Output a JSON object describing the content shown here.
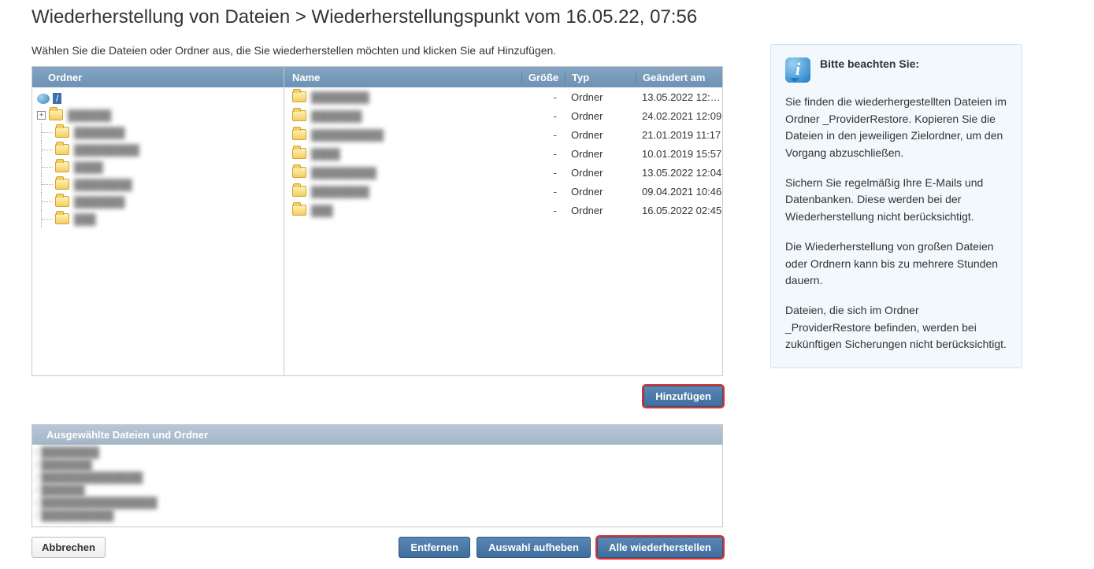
{
  "title": "Wiederherstellung von Dateien > Wiederherstellungspunkt vom 16.05.22, 07:56",
  "instructions": "Wählen Sie die Dateien oder Ordner aus, die Sie wiederherstellen möchten und klicken Sie auf Hinzufügen.",
  "tree": {
    "header": "Ordner",
    "root": "/",
    "items": [
      "██████",
      "███████",
      "█████████",
      "████",
      "████████",
      "███████",
      "███"
    ]
  },
  "list": {
    "headers": {
      "name": "Name",
      "size": "Größe",
      "type": "Typ",
      "date": "Geändert am"
    },
    "rows": [
      {
        "name": "████████",
        "size": "-",
        "type": "Ordner",
        "date": "13.05.2022 12:…"
      },
      {
        "name": "███████",
        "size": "-",
        "type": "Ordner",
        "date": "24.02.2021 12:09"
      },
      {
        "name": "██████████",
        "size": "-",
        "type": "Ordner",
        "date": "21.01.2019 11:17"
      },
      {
        "name": "████",
        "size": "-",
        "type": "Ordner",
        "date": "10.01.2019 15:57"
      },
      {
        "name": "█████████",
        "size": "-",
        "type": "Ordner",
        "date": "13.05.2022 12:04"
      },
      {
        "name": "████████",
        "size": "-",
        "type": "Ordner",
        "date": "09.04.2021 10:46"
      },
      {
        "name": "███",
        "size": "-",
        "type": "Ordner",
        "date": "16.05.2022 02:45"
      }
    ]
  },
  "buttons": {
    "add": "Hinzufügen",
    "cancel": "Abbrechen",
    "remove": "Entfernen",
    "deselect": "Auswahl aufheben",
    "restore_all": "Alle wiederherstellen"
  },
  "selected": {
    "header": "Ausgewählte Dateien und Ordner",
    "items": [
      "/ ████████",
      "/ ███████",
      "/ ██████████████",
      "/ ██████",
      "/ ████████████████",
      "/ ██████████"
    ]
  },
  "info": {
    "title": "Bitte beachten Sie:",
    "p1": "Sie finden die wiederhergestellten Dateien im Ordner _ProviderRestore. Kopieren Sie die Dateien in den jeweiligen Zielordner, um den Vorgang abzuschließen.",
    "p2": "Sichern Sie regelmäßig Ihre E-Mails und Datenbanken. Diese werden bei der Wiederherstellung nicht berücksichtigt.",
    "p3": "Die Wiederherstellung von großen Dateien oder Ordnern kann bis zu mehrere Stunden dauern.",
    "p4": "Dateien, die sich im Ordner _ProviderRestore befinden, werden bei zukünftigen Sicherungen nicht berücksichtigt."
  }
}
